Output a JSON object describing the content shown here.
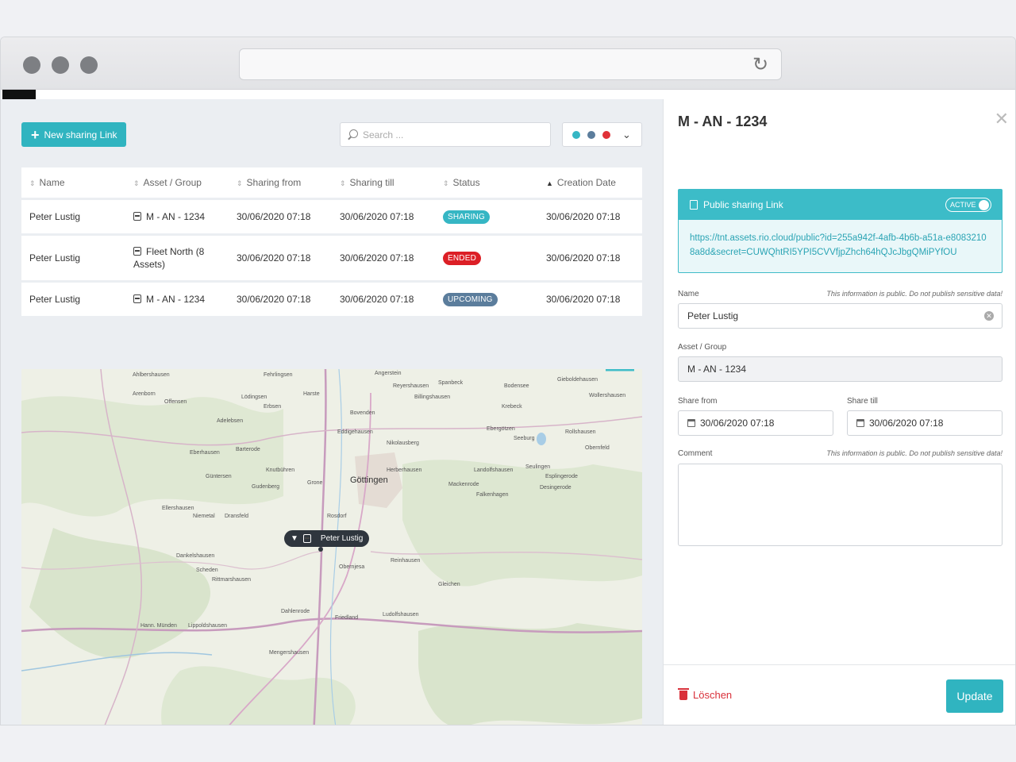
{
  "toolbar": {
    "new_link_label": "New sharing Link",
    "search_placeholder": "Search ..."
  },
  "filter": {
    "colors": [
      "#36b6c4",
      "#5b7d9c",
      "#e03238"
    ]
  },
  "table": {
    "headers": [
      "Name",
      "Asset / Group",
      "Sharing from",
      "Sharing till",
      "Status",
      "Creation Date"
    ],
    "rows": [
      {
        "name": "Peter Lustig",
        "asset": "M - AN - 1234",
        "from": "30/06/2020 07:18",
        "till": "30/06/2020 07:18",
        "status": "SHARING",
        "status_color": "#36b6c4",
        "created": "30/06/2020 07:18"
      },
      {
        "name": "Peter Lustig",
        "asset": "Fleet North (8 Assets)",
        "from": "30/06/2020 07:18",
        "till": "30/06/2020 07:18",
        "status": "ENDED",
        "status_color": "#dc1f26",
        "created": "30/06/2020 07:18"
      },
      {
        "name": "Peter Lustig",
        "asset": "M - AN - 1234",
        "from": "30/06/2020 07:18",
        "till": "30/06/2020 07:18",
        "status": "UPCOMING",
        "status_color": "#5b7d9c",
        "created": "30/06/2020 07:18"
      }
    ]
  },
  "map": {
    "city": "Göttingen",
    "marker_label": "Peter Lustig",
    "places": [
      "Ahlbershausen",
      "Fehrlingsen",
      "Angerstein",
      "Spanbeck",
      "Gieboldehausen",
      "Arenborn",
      "Lödingsen",
      "Harste",
      "Reyershausen",
      "Bodensee",
      "Offensen",
      "Erbsen",
      "Billingshausen",
      "Krebeck",
      "Wollershausen",
      "Adelebsen",
      "Bovenden",
      "Ebergötzen",
      "Barterode",
      "Eddigehausen",
      "Seeburg",
      "Rollshausen",
      "Eberhausen",
      "Nikolausberg",
      "Obernfeld",
      "Knutbühren",
      "Herberhausen",
      "Landolfshausen",
      "Seulingen",
      "Güntersen",
      "Mackenrode",
      "Esplingerode",
      "Gudenberg",
      "Grone",
      "Rosdorf",
      "Falkenhagen",
      "Desingerode",
      "Ellershausen",
      "Niemetal",
      "Dransfeld",
      "Obernjesa",
      "Reinhausen",
      "Rittmarshausen",
      "Gleichen",
      "Dankelshausen",
      "Scheden",
      "Friedland",
      "Dahlenrode",
      "Lippoldshausen",
      "Hann. Münden",
      "Ludolfshausen",
      "Mengershausen"
    ]
  },
  "panel": {
    "title": "M - AN - 1234",
    "share_header": "Public sharing Link",
    "toggle_label": "ACTIVE",
    "url": "https://tnt.assets.rio.cloud/public?id=255a942f-4afb-4b6b-a51a-e80832108a8d&secret=CUWQhtRI5YPI5CVVfjpZhch64hQJcJbgQMiPYfOU",
    "name_label": "Name",
    "public_note": "This information is public. Do not publish sensitive data!",
    "name_value": "Peter Lustig",
    "asset_label": "Asset / Group",
    "asset_value": "M - AN - 1234",
    "from_label": "Share from",
    "from_value": "30/06/2020 07:18",
    "till_label": "Share till",
    "till_value": "30/06/2020 07:18",
    "comment_label": "Comment",
    "comment_note": "This information is public. Do not publish sensitive data!",
    "delete_label": "Löschen",
    "update_label": "Update"
  }
}
